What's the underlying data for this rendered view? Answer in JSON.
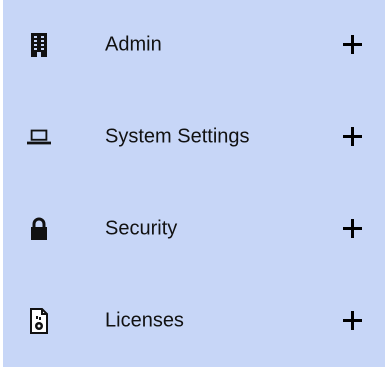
{
  "colors": {
    "panel_background": "#c7d6f7",
    "text": "#111111",
    "icon": "#111111"
  },
  "menu": {
    "items": [
      {
        "label": "Admin",
        "icon": "building-icon",
        "expand_icon": "plus-icon"
      },
      {
        "label": "System Settings",
        "icon": "laptop-icon",
        "expand_icon": "plus-icon"
      },
      {
        "label": "Security",
        "icon": "lock-icon",
        "expand_icon": "plus-icon"
      },
      {
        "label": "Licenses",
        "icon": "certificate-file-icon",
        "expand_icon": "plus-icon"
      }
    ]
  }
}
